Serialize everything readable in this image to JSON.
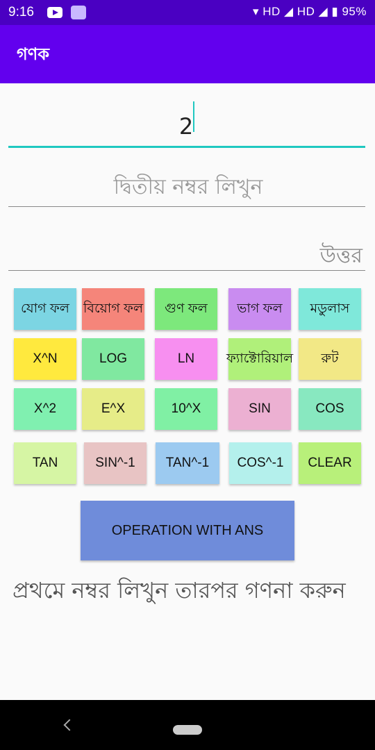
{
  "status": {
    "time": "9:16",
    "indicators": "▾ HD ◢ HD ◢ ▮ 95%"
  },
  "app_title": "গণক",
  "first_number": {
    "value": "2"
  },
  "second_number": {
    "placeholder": "দ্বিতীয় নম্বর লিখুন"
  },
  "answer": {
    "label": "উত্তর"
  },
  "buttons": [
    {
      "label": "যোগ ফল",
      "color": "#7cd5e3"
    },
    {
      "label": "বিয়োগ ফল",
      "color": "#f5857a"
    },
    {
      "label": "গুণ ফল",
      "color": "#7de87c"
    },
    {
      "label": "ভাগ ফল",
      "color": "#c98cf0"
    },
    {
      "label": "মডুলাস",
      "color": "#7fe8da"
    },
    {
      "label": "X^N",
      "color": "#ffe93e"
    },
    {
      "label": "LOG",
      "color": "#80e8a0"
    },
    {
      "label": "LN",
      "color": "#f78ff0"
    },
    {
      "label": "ফ্যাক্টোরিয়াল",
      "color": "#b0f07a"
    },
    {
      "label": "রুট",
      "color": "#f2e886"
    },
    {
      "label": "X^2",
      "color": "#80f0b0"
    },
    {
      "label": "E^X",
      "color": "#e6ec88"
    },
    {
      "label": "10^X",
      "color": "#80f0a4"
    },
    {
      "label": "SIN",
      "color": "#ecb0d2"
    },
    {
      "label": "COS",
      "color": "#88e8c0"
    },
    {
      "label": "TAN",
      "color": "#d6f5a4"
    },
    {
      "label": "SIN^-1",
      "color": "#e8c4c4"
    },
    {
      "label": "TAN^-1",
      "color": "#9ccaf0"
    },
    {
      "label": "COS^-1",
      "color": "#b4f0ec"
    },
    {
      "label": "CLEAR",
      "color": "#b8f07a"
    }
  ],
  "operation_button": "OPERATION WITH ANS",
  "hint": "প্রথমে নম্বর লিখুন তারপর গণনা করুন"
}
